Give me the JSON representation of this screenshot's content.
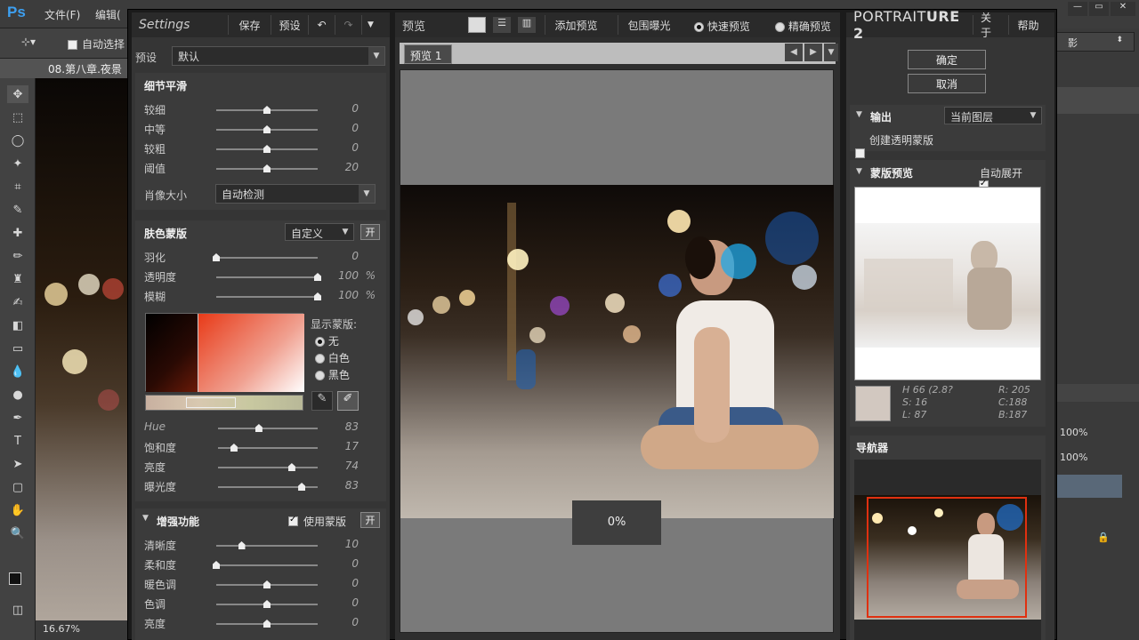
{
  "photoshop": {
    "logo": "Ps",
    "menu": [
      "文件(F)",
      "编辑("
    ],
    "option_auto_select": "自动选择",
    "doc_tab": "08.第八章.夜景",
    "zoom": "16.67%",
    "layer_opacity_1": "100%",
    "layer_opacity_2": "100%",
    "right_label": "影"
  },
  "left_panel": {
    "title": "Settings",
    "save": "保存",
    "preset_btn": "预设",
    "preset_label": "预设",
    "preset_value": "默认",
    "detail_title": "细节平滑",
    "detail_rows": [
      {
        "label": "较细",
        "value": "0",
        "pos": 0.5
      },
      {
        "label": "中等",
        "value": "0",
        "pos": 0.5
      },
      {
        "label": "较粗",
        "value": "0",
        "pos": 0.5
      },
      {
        "label": "阈值",
        "value": "20",
        "pos": 0.5
      }
    ],
    "portrait_size_label": "肖像大小",
    "portrait_size_value": "自动检测",
    "skin_title": "肤色蒙版",
    "skin_mode": "自定义",
    "skin_toggle": "开",
    "skin_rows": [
      {
        "label": "羽化",
        "value": "0",
        "unit": "",
        "pos": 0.0
      },
      {
        "label": "透明度",
        "value": "100",
        "unit": "%",
        "pos": 1.0
      },
      {
        "label": "模糊",
        "value": "100",
        "unit": "%",
        "pos": 1.0
      }
    ],
    "show_mask_label": "显示蒙版:",
    "mask_options": [
      "无",
      "白色",
      "黑色"
    ],
    "hue_rows": [
      {
        "label": "Hue",
        "value": "83",
        "pos": 0.41
      },
      {
        "label": "饱和度",
        "value": "17",
        "pos": 0.16
      },
      {
        "label": "亮度",
        "value": "74",
        "pos": 0.74
      },
      {
        "label": "曝光度",
        "value": "83",
        "pos": 0.84
      }
    ],
    "enhance_title": "增强功能",
    "use_mask_label": "使用蒙版",
    "enhance_toggle": "开",
    "enhance_rows": [
      {
        "label": "清晰度",
        "value": "10",
        "pos": 0.25
      },
      {
        "label": "柔和度",
        "value": "0",
        "pos": 0.0
      },
      {
        "label": "暖色调",
        "value": "0",
        "pos": 0.5
      },
      {
        "label": "色调",
        "value": "0",
        "pos": 0.5
      },
      {
        "label": "亮度",
        "value": "0",
        "pos": 0.5
      }
    ]
  },
  "center_panel": {
    "title": "预览",
    "add_preview": "添加预览",
    "bracket": "包围曝光",
    "fast_preview": "快速预览",
    "accurate_preview": "精确预览",
    "preview_tab": "预览 1",
    "progress": "0%"
  },
  "right_panel": {
    "title_prefix": "PORTRAIT",
    "title_suffix": "URE 2",
    "about": "关于",
    "help": "帮助",
    "ok": "确定",
    "cancel": "取消",
    "output_title": "输出",
    "output_value": "当前图层",
    "create_mask": "创建透明蒙版",
    "mask_preview_title": "蒙版预览",
    "auto_expand": "自动展开",
    "hsl": {
      "h": "H 66 (2.8?",
      "s": "S: 16",
      "l": "L: 87"
    },
    "rgb": {
      "r": "R: 205",
      "c": "C:188",
      "b": "B:187"
    },
    "navigator_title": "导航器"
  },
  "colors": {
    "accent": "#3d9ff0",
    "nav_rect": "#e03010"
  }
}
